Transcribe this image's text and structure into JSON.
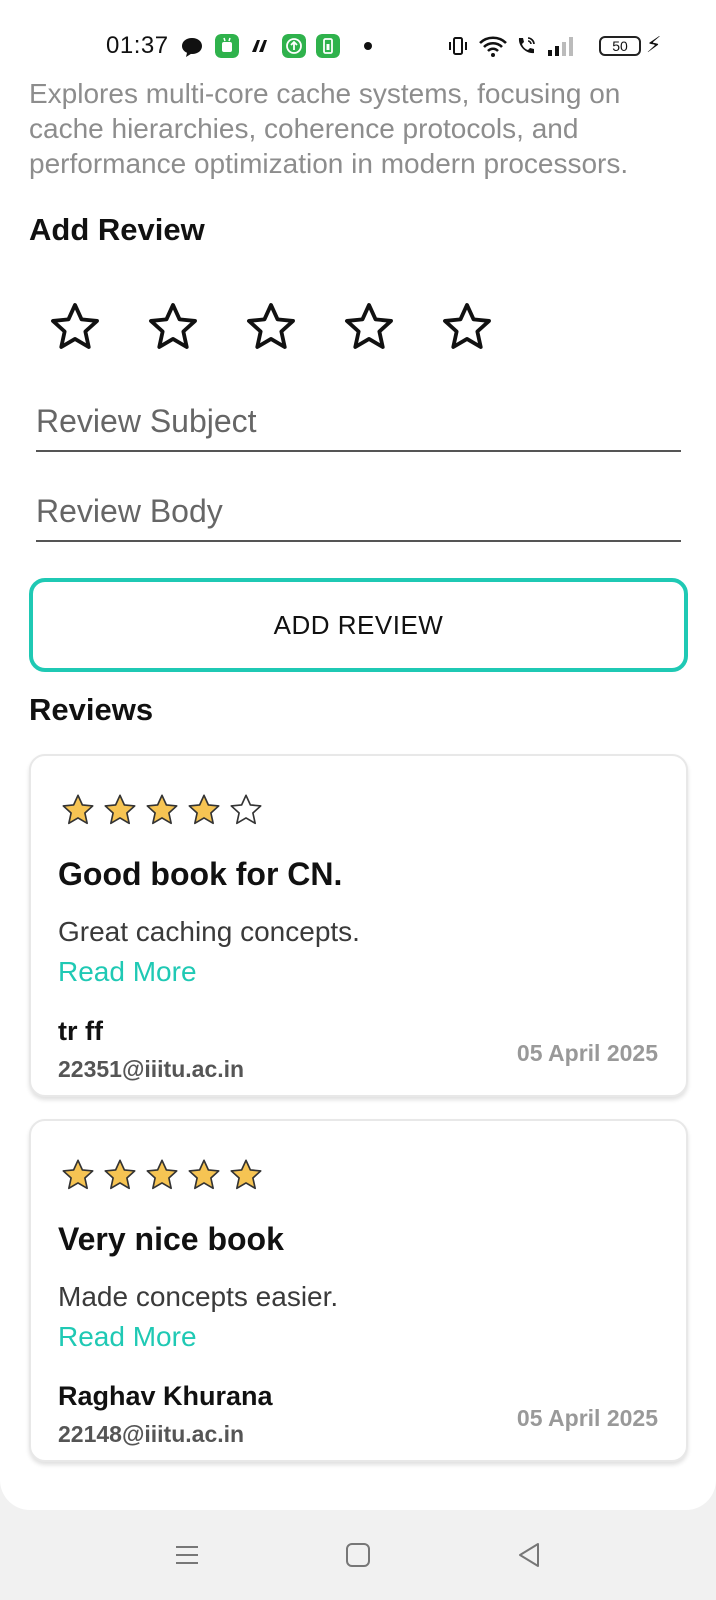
{
  "status_bar": {
    "time": "01:37",
    "battery": "50",
    "app_icons": [
      {
        "name": "chat-bubble-icon",
        "color": "#111111"
      },
      {
        "name": "android-app-icon",
        "color": "#2fb24c"
      },
      {
        "name": "brush-app-icon",
        "color": "#111111"
      },
      {
        "name": "upload-app-icon",
        "color": "#2fb24c"
      },
      {
        "name": "battery-saver-app-icon",
        "color": "#2fb24c"
      }
    ]
  },
  "book": {
    "description": "Explores multi-core cache systems, focusing on cache hierarchies, coherence protocols, and performance optimization in modern processors."
  },
  "add_review": {
    "title": "Add Review",
    "rating_stars": 5,
    "subject_placeholder": "Review Subject",
    "body_placeholder": "Review Body",
    "button_label": "ADD REVIEW"
  },
  "reviews_section": {
    "title": "Reviews",
    "items": [
      {
        "rating": 4,
        "max_rating": 5,
        "subject": "Good book for CN.",
        "body": "Great caching concepts.",
        "read_more": "Read More",
        "author": "tr ff",
        "email": "22351@iiitu.ac.in",
        "date": "05 April 2025"
      },
      {
        "rating": 5,
        "max_rating": 5,
        "subject": "Very nice book",
        "body": "Made concepts easier.",
        "read_more": "Read More",
        "author": "Raghav Khurana",
        "email": "22148@iiitu.ac.in",
        "date": "05 April 2025"
      }
    ]
  },
  "colors": {
    "accent": "#1fc9b4",
    "star_fill": "#f6c453",
    "muted_text": "#8d8d8d"
  }
}
